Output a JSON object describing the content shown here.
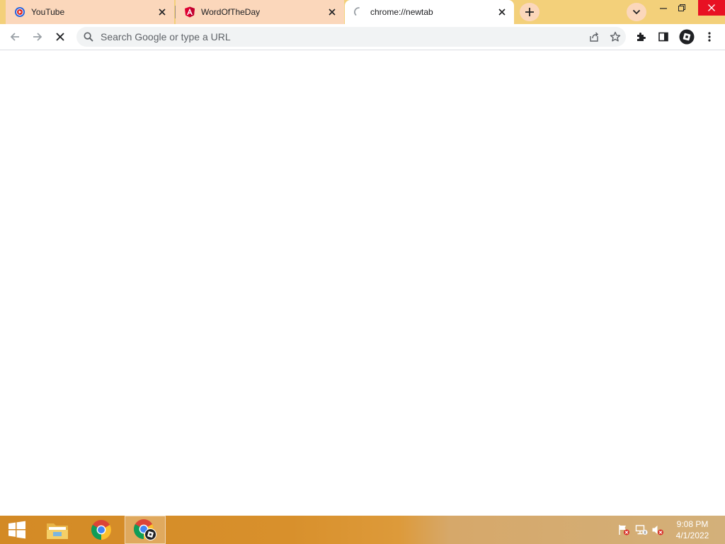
{
  "browser": {
    "tabs": [
      {
        "title": "YouTube",
        "favicon": "youtube-favicon",
        "state": "inactive"
      },
      {
        "title": "WordOfTheDay",
        "favicon": "angular-favicon",
        "state": "inactive"
      },
      {
        "title": "chrome://newtab",
        "favicon": "loading-spinner",
        "state": "active"
      }
    ],
    "omnibox": {
      "placeholder": "Search Google or type a URL",
      "value": ""
    },
    "colors": {
      "frame": "#f3d07a",
      "inactive_tab": "#fbd7bb",
      "active_tab": "#ffffff",
      "omnibox": "#f1f3f4"
    }
  },
  "taskbar": {
    "apps": [
      {
        "name": "start-button"
      },
      {
        "name": "file-explorer"
      },
      {
        "name": "google-chrome"
      },
      {
        "name": "google-chrome-profile",
        "active": true
      }
    ],
    "clock": {
      "time": "9:08 PM",
      "date": "4/1/2022"
    }
  }
}
